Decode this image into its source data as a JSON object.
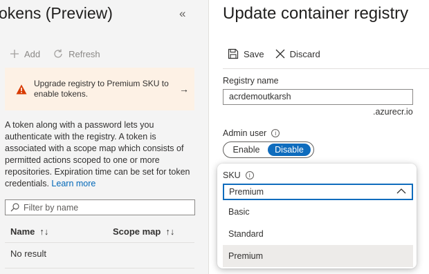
{
  "left_blade": {
    "title": "okens (Preview)",
    "collapse_glyph": "«",
    "toolbar": {
      "add_label": "Add",
      "refresh_label": "Refresh"
    },
    "banner": {
      "text": "Upgrade registry to Premium SKU to enable tokens.",
      "arrow": "→"
    },
    "description": "A token along with a password lets you authenticate with the registry. A token is associated with a scope map which consists of permitted actions scoped to one or more repositories. Expiration time can be set for token credentials.",
    "learn_more": "Learn more",
    "filter_placeholder": "Filter by name",
    "table": {
      "columns": [
        "Name",
        "Scope map"
      ],
      "sort_glyph": "↑↓",
      "empty_text": "No result"
    }
  },
  "right_blade": {
    "title": "Update container registry",
    "toolbar": {
      "save_label": "Save",
      "discard_label": "Discard"
    },
    "registry_name": {
      "label": "Registry name",
      "value": "acrdemoutkarsh",
      "suffix": ".azurecr.io"
    },
    "admin_user": {
      "label": "Admin user",
      "info_glyph": "i",
      "options": [
        "Enable",
        "Disable"
      ],
      "selected": "Disable"
    },
    "sku": {
      "label": "SKU",
      "info_glyph": "i",
      "value": "Premium",
      "options": [
        "Basic",
        "Standard",
        "Premium"
      ],
      "selected": "Premium"
    }
  },
  "colors": {
    "accent": "#0f6cbd",
    "link": "#0067b8",
    "warning": "#d83b01",
    "banner_bg": "#fdf1e5"
  }
}
